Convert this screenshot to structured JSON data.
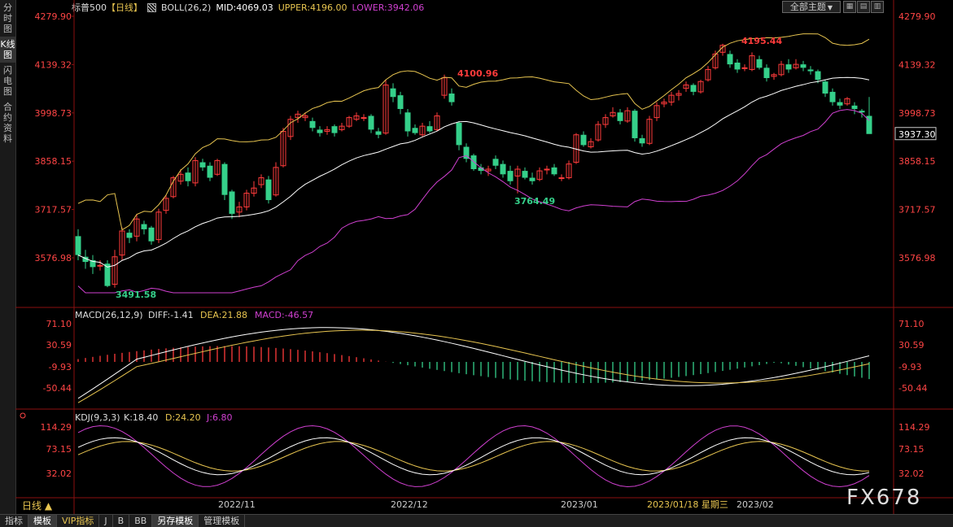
{
  "sidebar": {
    "items": [
      {
        "label": "分时图",
        "active": false
      },
      {
        "label": "K线图",
        "active": true
      },
      {
        "label": "闪电图",
        "active": false
      },
      {
        "label": "合约资料",
        "active": false
      }
    ]
  },
  "header": {
    "symbol": "标普500",
    "period": "【日线】",
    "indicator": "BOLL(26,2)",
    "mid": "MID:4069.03",
    "upper": "UPPER:4196.00",
    "lower": "LOWER:3942.06",
    "theme_button": "全部主题",
    "theme_caret": "▼"
  },
  "price_axis": {
    "ticks": [
      "4279.90",
      "4139.32",
      "3998.73",
      "3858.15",
      "3717.57",
      "3576.98"
    ],
    "current": "3937.30"
  },
  "annotations": {
    "high1": "4100.96",
    "high2": "4195.44",
    "low1": "3491.58",
    "low2": "3764.49"
  },
  "macd": {
    "title": "MACD(26,12,9)",
    "diff": "DIFF:-1.41",
    "dea": "DEA:21.88",
    "macd": "MACD:-46.57",
    "ticks": [
      "71.10",
      "30.59",
      "-9.93",
      "-50.44"
    ]
  },
  "kdj": {
    "title": "KDJ(9,3,3)",
    "k": "K:18.40",
    "d": "D:24.20",
    "j": "J:6.80",
    "ticks": [
      "114.29",
      "73.15",
      "32.02"
    ]
  },
  "time_axis": {
    "labels": [
      "2022/11",
      "2022/12",
      "2023/01",
      "2023/01/18 星期三",
      "2023/02"
    ]
  },
  "bottom": {
    "period_label": "日线 ▲",
    "tabs": [
      {
        "label": "指标",
        "active": false,
        "vip": false
      },
      {
        "label": "模板",
        "active": true,
        "vip": false
      },
      {
        "label": "VIP指标",
        "active": false,
        "vip": true
      },
      {
        "label": "J",
        "active": false,
        "vip": false
      },
      {
        "label": "B",
        "active": false,
        "vip": false
      },
      {
        "label": "BB",
        "active": false,
        "vip": false
      },
      {
        "label": "另存模板",
        "active": true,
        "vip": false
      },
      {
        "label": "管理模板",
        "active": false,
        "vip": false
      }
    ]
  },
  "watermark": "FX678",
  "colors": {
    "up": "#ff3b3b",
    "down": "#35d08a",
    "upper": "#e8c550",
    "mid": "#ffffff",
    "lower": "#d040d0",
    "axis_text": "#ff4545",
    "neg_axis_text": "#ff4545"
  },
  "chart_data": {
    "type": "candlestick",
    "ylim": [
      3491.58,
      4279.9
    ],
    "candles": [
      [
        3640,
        3585,
        3660,
        3570
      ],
      [
        3580,
        3565,
        3600,
        3545
      ],
      [
        3570,
        3550,
        3585,
        3530
      ],
      [
        3555,
        3555,
        3570,
        3540
      ],
      [
        3560,
        3495,
        3570,
        3491.58
      ],
      [
        3500,
        3580,
        3600,
        3490
      ],
      [
        3585,
        3655,
        3665,
        3570
      ],
      [
        3650,
        3635,
        3660,
        3620
      ],
      [
        3640,
        3690,
        3705,
        3625
      ],
      [
        3675,
        3660,
        3685,
        3645
      ],
      [
        3665,
        3625,
        3670,
        3615
      ],
      [
        3630,
        3710,
        3720,
        3620
      ],
      [
        3715,
        3750,
        3760,
        3705
      ],
      [
        3755,
        3810,
        3815,
        3750
      ],
      [
        3800,
        3820,
        3835,
        3790
      ],
      [
        3825,
        3800,
        3840,
        3785
      ],
      [
        3795,
        3860,
        3870,
        3785
      ],
      [
        3855,
        3840,
        3865,
        3830
      ],
      [
        3845,
        3810,
        3855,
        3800
      ],
      [
        3820,
        3860,
        3865,
        3815
      ],
      [
        3850,
        3760,
        3855,
        3745
      ],
      [
        3770,
        3705,
        3775,
        3690
      ],
      [
        3710,
        3725,
        3740,
        3695
      ],
      [
        3725,
        3765,
        3775,
        3715
      ],
      [
        3765,
        3780,
        3800,
        3755
      ],
      [
        3790,
        3810,
        3820,
        3780
      ],
      [
        3805,
        3745,
        3815,
        3735
      ],
      [
        3760,
        3840,
        3855,
        3755
      ],
      [
        3845,
        3945,
        3955,
        3840
      ],
      [
        3930,
        3980,
        3990,
        3920
      ],
      [
        3985,
        3995,
        4005,
        3970
      ],
      [
        3985,
        3990,
        4000,
        3975
      ],
      [
        3975,
        3955,
        3985,
        3945
      ],
      [
        3950,
        3940,
        3960,
        3930
      ],
      [
        3945,
        3950,
        3960,
        3935
      ],
      [
        3960,
        3940,
        3965,
        3930
      ],
      [
        3950,
        3960,
        3970,
        3945
      ],
      [
        3960,
        3985,
        3990,
        3955
      ],
      [
        3980,
        3990,
        4000,
        3975
      ],
      [
        3985,
        3985,
        3995,
        3975
      ],
      [
        3990,
        3950,
        3995,
        3940
      ],
      [
        3945,
        3935,
        3955,
        3925
      ],
      [
        3940,
        4080,
        4095,
        3935
      ],
      [
        4070,
        4045,
        4085,
        4030
      ],
      [
        4050,
        4010,
        4060,
        3995
      ],
      [
        4000,
        3945,
        4010,
        3930
      ],
      [
        3955,
        3940,
        3965,
        3935
      ],
      [
        3935,
        3960,
        3970,
        3930
      ],
      [
        3960,
        3945,
        3975,
        3940
      ],
      [
        3950,
        3990,
        4000,
        3945
      ],
      [
        4050,
        4100.96,
        4110,
        4040
      ],
      [
        4055,
        4030,
        4070,
        4020
      ],
      [
        3970,
        3905,
        3975,
        3890
      ],
      [
        3900,
        3865,
        3910,
        3855
      ],
      [
        3875,
        3835,
        3880,
        3830
      ],
      [
        3840,
        3830,
        3850,
        3820
      ],
      [
        3830,
        3835,
        3845,
        3815
      ],
      [
        3865,
        3845,
        3875,
        3835
      ],
      [
        3850,
        3820,
        3860,
        3810
      ],
      [
        3830,
        3800,
        3845,
        3790
      ],
      [
        3815,
        3835,
        3845,
        3764.49
      ],
      [
        3830,
        3810,
        3840,
        3805
      ],
      [
        3810,
        3800,
        3825,
        3790
      ],
      [
        3805,
        3830,
        3840,
        3800
      ],
      [
        3835,
        3835,
        3845,
        3820
      ],
      [
        3840,
        3820,
        3850,
        3815
      ],
      [
        3810,
        3810,
        3820,
        3800
      ],
      [
        3810,
        3850,
        3860,
        3805
      ],
      [
        3855,
        3935,
        3940,
        3850
      ],
      [
        3935,
        3905,
        3945,
        3900
      ],
      [
        3900,
        3915,
        3925,
        3895
      ],
      [
        3920,
        3965,
        3975,
        3915
      ],
      [
        3965,
        3985,
        3995,
        3955
      ],
      [
        3990,
        4000,
        4015,
        3985
      ],
      [
        4000,
        3975,
        4010,
        3965
      ],
      [
        3975,
        4005,
        4015,
        3970
      ],
      [
        4005,
        3925,
        4010,
        3915
      ],
      [
        3925,
        3910,
        3935,
        3900
      ],
      [
        3910,
        3980,
        3990,
        3905
      ],
      [
        3985,
        4020,
        4030,
        3975
      ],
      [
        4025,
        4030,
        4040,
        4015
      ],
      [
        4030,
        4050,
        4060,
        4020
      ],
      [
        4050,
        4055,
        4065,
        4035
      ],
      [
        4070,
        4080,
        4090,
        4060
      ],
      [
        4080,
        4060,
        4085,
        4050
      ],
      [
        4060,
        4090,
        4095,
        4055
      ],
      [
        4095,
        4125,
        4135,
        4090
      ],
      [
        4130,
        4170,
        4180,
        4125
      ],
      [
        4175,
        4195.44,
        4200,
        4165
      ],
      [
        4170,
        4140,
        4180,
        4130
      ],
      [
        4145,
        4125,
        4155,
        4115
      ],
      [
        4130,
        4130,
        4140,
        4120
      ],
      [
        4125,
        4165,
        4175,
        4120
      ],
      [
        4155,
        4130,
        4165,
        4125
      ],
      [
        4130,
        4100,
        4140,
        4090
      ],
      [
        4105,
        4110,
        4115,
        4095
      ],
      [
        4110,
        4140,
        4150,
        4105
      ],
      [
        4140,
        4125,
        4155,
        4115
      ],
      [
        4130,
        4140,
        4155,
        4125
      ],
      [
        4140,
        4130,
        4150,
        4120
      ],
      [
        4125,
        4120,
        4135,
        4110
      ],
      [
        4120,
        4095,
        4125,
        4085
      ],
      [
        4090,
        4055,
        4095,
        4045
      ],
      [
        4060,
        4030,
        4070,
        4020
      ],
      [
        4030,
        4020,
        4040,
        4010
      ],
      [
        4025,
        4040,
        4045,
        4020
      ],
      [
        4020,
        4010,
        4030,
        3995
      ],
      [
        4005,
        4000,
        4010,
        3985
      ],
      [
        3990,
        3937.3,
        4045,
        3985
      ]
    ]
  }
}
